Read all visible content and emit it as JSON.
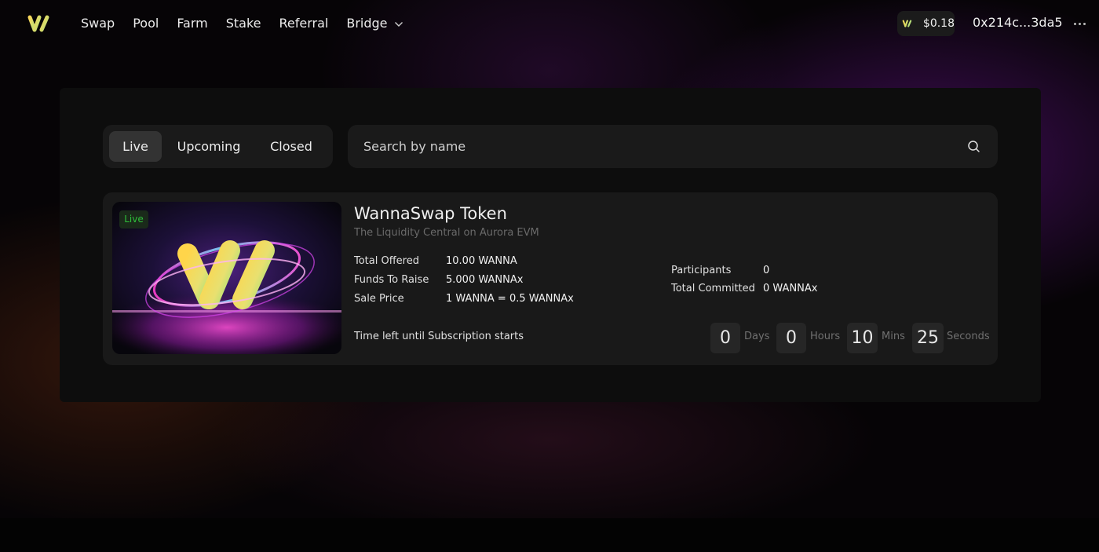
{
  "nav": {
    "links": [
      "Swap",
      "Pool",
      "Farm",
      "Stake",
      "Referral",
      "Bridge"
    ],
    "token_price": "$0.18",
    "wallet_address": "0x214c...3da5"
  },
  "filters": {
    "tabs": [
      "Live",
      "Upcoming",
      "Closed"
    ],
    "active_tab": "Live",
    "search_placeholder": "Search by name"
  },
  "sale": {
    "status_badge": "Live",
    "name": "WannaSwap Token",
    "subtitle": "The Liquidity Central on Aurora EVM",
    "details": [
      {
        "label": "Total Offered",
        "value": "10.00 WANNA"
      },
      {
        "label": "Funds To Raise",
        "value": "5.000 WANNAx"
      },
      {
        "label": "Sale Price",
        "value": "1 WANNA = 0.5 WANNAx"
      }
    ],
    "stats": [
      {
        "label": "Participants",
        "value": "0"
      },
      {
        "label": "Total Committed",
        "value": "0 WANNAx"
      }
    ],
    "countdown_label": "Time left until Subscription starts",
    "countdown": [
      {
        "value": "0",
        "unit": "Days"
      },
      {
        "value": "0",
        "unit": "Hours"
      },
      {
        "value": "10",
        "unit": "Mins"
      },
      {
        "value": "25",
        "unit": "Seconds"
      }
    ]
  },
  "colors": {
    "live_green": "#2fbf3a",
    "card_bg": "#191919",
    "panel_bg": "#0d0d0d"
  }
}
